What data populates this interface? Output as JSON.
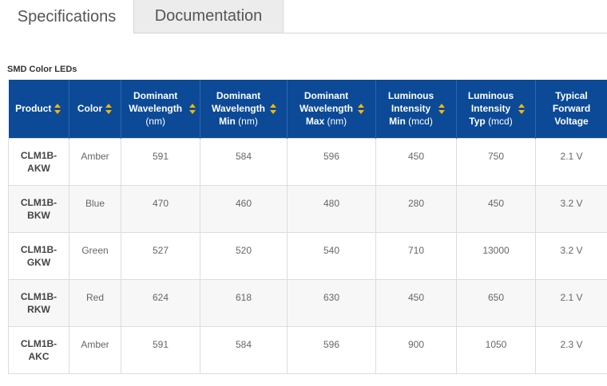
{
  "tabs": [
    {
      "label": "Specifications",
      "active": true
    },
    {
      "label": "Documentation",
      "active": false
    }
  ],
  "section_title": "SMD Color LEDs",
  "table": {
    "columns": [
      {
        "label": "Product",
        "unit": ""
      },
      {
        "label": "Color",
        "unit": ""
      },
      {
        "label": "Dominant Wavelength",
        "unit": "(nm)"
      },
      {
        "label": "Dominant Wavelength Min",
        "unit": "(nm)"
      },
      {
        "label": "Dominant Wavelength Max",
        "unit": "(nm)"
      },
      {
        "label": "Luminous Intensity Min",
        "unit": "(mcd)"
      },
      {
        "label": "Luminous Intensity Typ",
        "unit": "(mcd)"
      },
      {
        "label": "Typical Forward Voltage",
        "unit": ""
      }
    ],
    "rows": [
      [
        "CLM1B-AKW",
        "Amber",
        "591",
        "584",
        "596",
        "450",
        "750",
        "2.1 V"
      ],
      [
        "CLM1B-BKW",
        "Blue",
        "470",
        "460",
        "480",
        "280",
        "450",
        "3.2 V"
      ],
      [
        "CLM1B-GKW",
        "Green",
        "527",
        "520",
        "540",
        "710",
        "13000",
        "3.2 V"
      ],
      [
        "CLM1B-RKW",
        "Red",
        "624",
        "618",
        "630",
        "450",
        "650",
        "2.1 V"
      ],
      [
        "CLM1B-AKC",
        "Amber",
        "591",
        "584",
        "596",
        "900",
        "1050",
        "2.3 V"
      ]
    ]
  },
  "colors": {
    "header_bg": "#0c4a97",
    "sort_arrow": "#f5b800"
  }
}
